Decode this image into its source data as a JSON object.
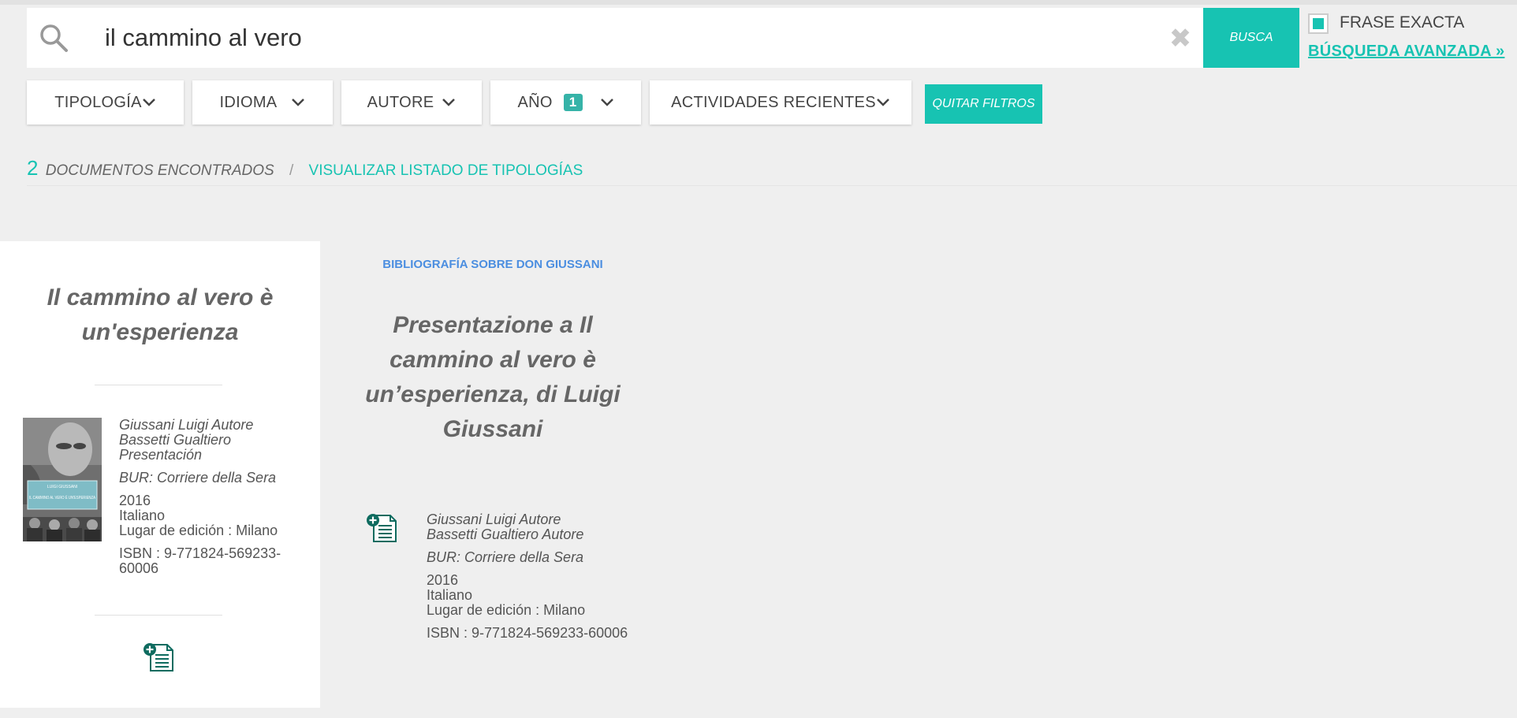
{
  "search": {
    "query": "il cammino al vero",
    "button_label": "BUSCA",
    "exact_label": "FRASE EXACTA",
    "advanced_label": "BÚSQUEDA AVANZADA »"
  },
  "filters": [
    {
      "label": "TIPOLOGÍA"
    },
    {
      "label": "IDIOMA"
    },
    {
      "label": "AUTORE"
    },
    {
      "label": "AÑO",
      "badge": "1"
    },
    {
      "label": "ACTIVIDADES RECIENTES"
    }
  ],
  "clear_filters_label": "QUITAR FILTROS",
  "results": {
    "count": "2",
    "label": "DOCUMENTOS ENCONTRADOS",
    "separator": "/",
    "typologies_link": "VISUALIZAR LISTADO DE TIPOLOGÍAS"
  },
  "cards": [
    {
      "title": "Il cammino al vero è un'esperienza",
      "cover_author": "LUIGI GIUSSANI",
      "cover_title": "IL CAMMINO AL VERO È UN'ESPERIENZA",
      "authors": [
        "Giussani Luigi Autore",
        "Bassetti Gualtiero Presentación"
      ],
      "publisher": "BUR: Corriere della Sera",
      "year": "2016",
      "language": "Italiano",
      "place": "Lugar de edición : Milano",
      "isbn": "ISBN : 9-771824-569233-60006"
    },
    {
      "category": "BIBLIOGRAFÍA SOBRE DON GIUSSANI",
      "title": "Presentazione a Il cammino al vero è un’esperienza, di Luigi Giussani",
      "authors": [
        "Giussani Luigi Autore",
        "Bassetti Gualtiero Autore"
      ],
      "publisher": "BUR: Corriere della Sera",
      "year": "2016",
      "language": "Italiano",
      "place": "Lugar de edición : Milano",
      "isbn": "ISBN : 9-771824-569233-60006"
    }
  ],
  "colors": {
    "accent": "#17c3b2",
    "category_link": "#4b8ee0",
    "doc_icon": "#0e6b5f",
    "background": "#efefef"
  },
  "icons": [
    "search-icon",
    "clear-icon",
    "chevron-down-icon",
    "document-add-icon"
  ]
}
